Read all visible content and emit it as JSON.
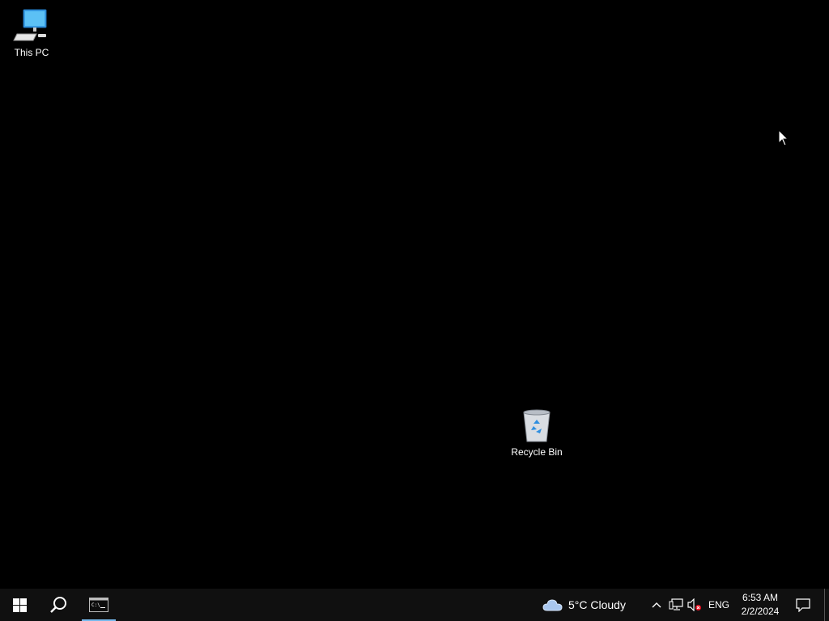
{
  "desktop": {
    "background_color": "#000000",
    "icons": [
      {
        "label": "This PC",
        "icon": "computer-icon"
      },
      {
        "label": "Recycle Bin",
        "icon": "recycle-bin-icon"
      }
    ]
  },
  "taskbar": {
    "background_color": "#101010",
    "start": {
      "icon": "windows-logo-icon"
    },
    "search": {
      "icon": "search-icon"
    },
    "apps": [
      {
        "name": "Command Prompt",
        "icon": "command-prompt-icon",
        "active": true,
        "indicator_color": "#76b9ed"
      }
    ],
    "weather": {
      "icon": "cloud-icon",
      "text": "5°C  Cloudy"
    },
    "tray": {
      "chevron_icon": "chevron-up-icon",
      "network_icon": "network-icon",
      "volume_icon": "volume-muted-icon",
      "language": "ENG"
    },
    "clock": {
      "time": "6:53 AM",
      "date": "2/2/2024"
    },
    "notifications_icon": "action-center-icon"
  }
}
